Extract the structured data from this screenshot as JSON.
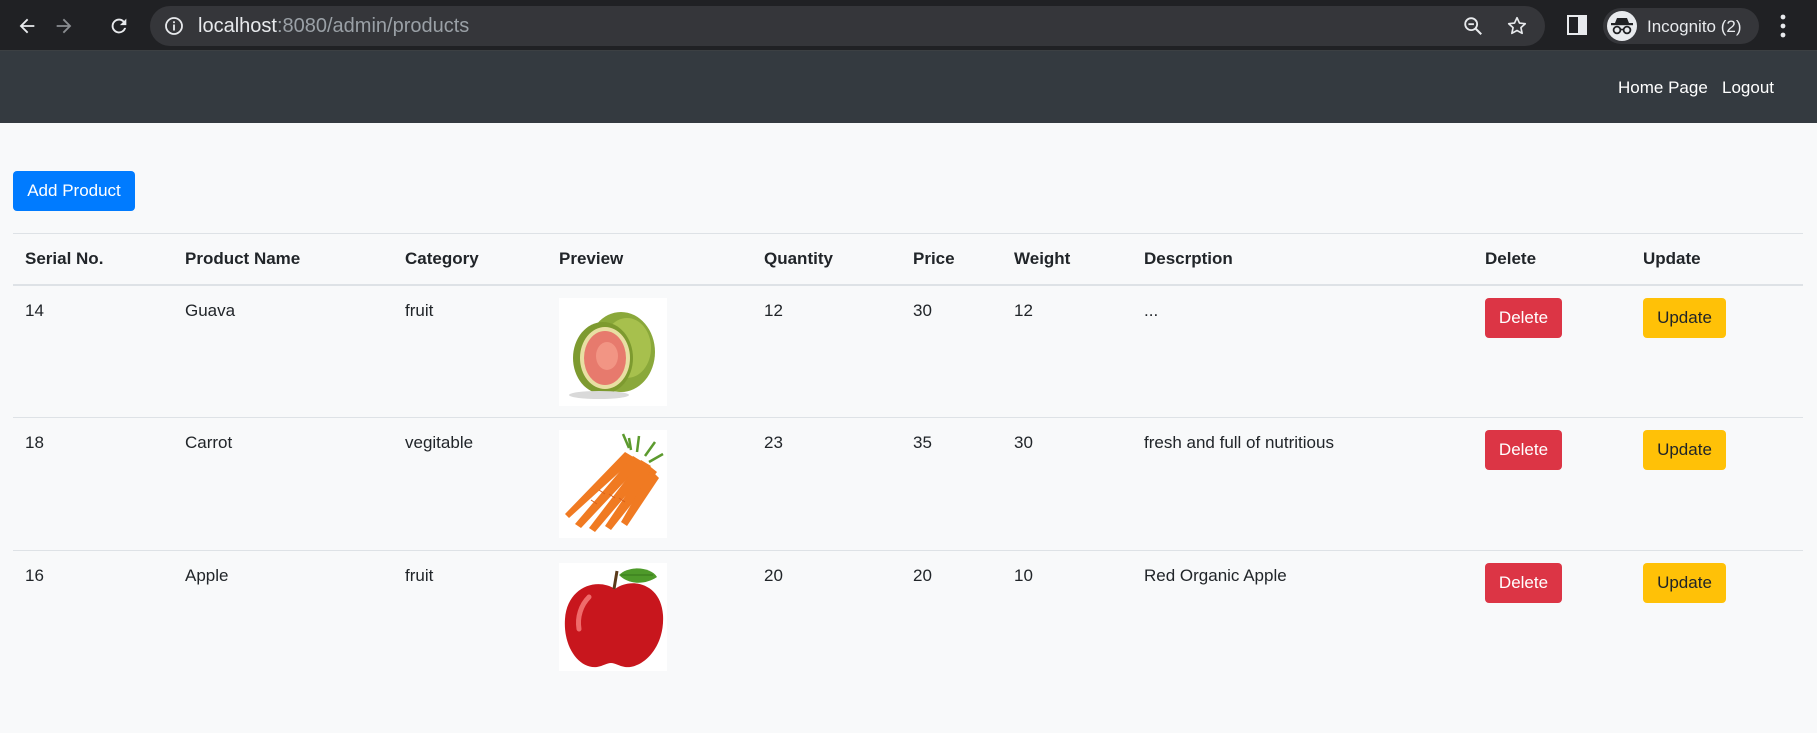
{
  "browser": {
    "url_host": "localhost",
    "url_rest": ":8080/admin/products",
    "profile_label": "Incognito (2)"
  },
  "navbar": {
    "links": [
      "Home Page",
      "Logout"
    ]
  },
  "actions": {
    "add_product_label": "Add Product"
  },
  "table": {
    "headers": [
      "Serial No.",
      "Product Name",
      "Category",
      "Preview",
      "Quantity",
      "Price",
      "Weight",
      "Descrption",
      "Delete",
      "Update"
    ],
    "rows": [
      {
        "serial": "14",
        "name": "Guava",
        "category": "fruit",
        "preview": "guava-image",
        "quantity": "12",
        "price": "30",
        "weight": "12",
        "description": "...",
        "delete_label": "Delete",
        "update_label": "Update"
      },
      {
        "serial": "18",
        "name": "Carrot",
        "category": "vegitable",
        "preview": "carrot-image",
        "quantity": "23",
        "price": "35",
        "weight": "30",
        "description": "fresh and full of nutritious",
        "delete_label": "Delete",
        "update_label": "Update"
      },
      {
        "serial": "16",
        "name": "Apple",
        "category": "fruit",
        "preview": "apple-image",
        "quantity": "20",
        "price": "20",
        "weight": "10",
        "description": "Red Organic Apple",
        "delete_label": "Delete",
        "update_label": "Update"
      }
    ]
  },
  "colors": {
    "navbar_bg": "#343a40",
    "primary": "#007bff",
    "danger": "#dc3545",
    "warning": "#ffc107",
    "page_bg": "#f8f9fa"
  }
}
